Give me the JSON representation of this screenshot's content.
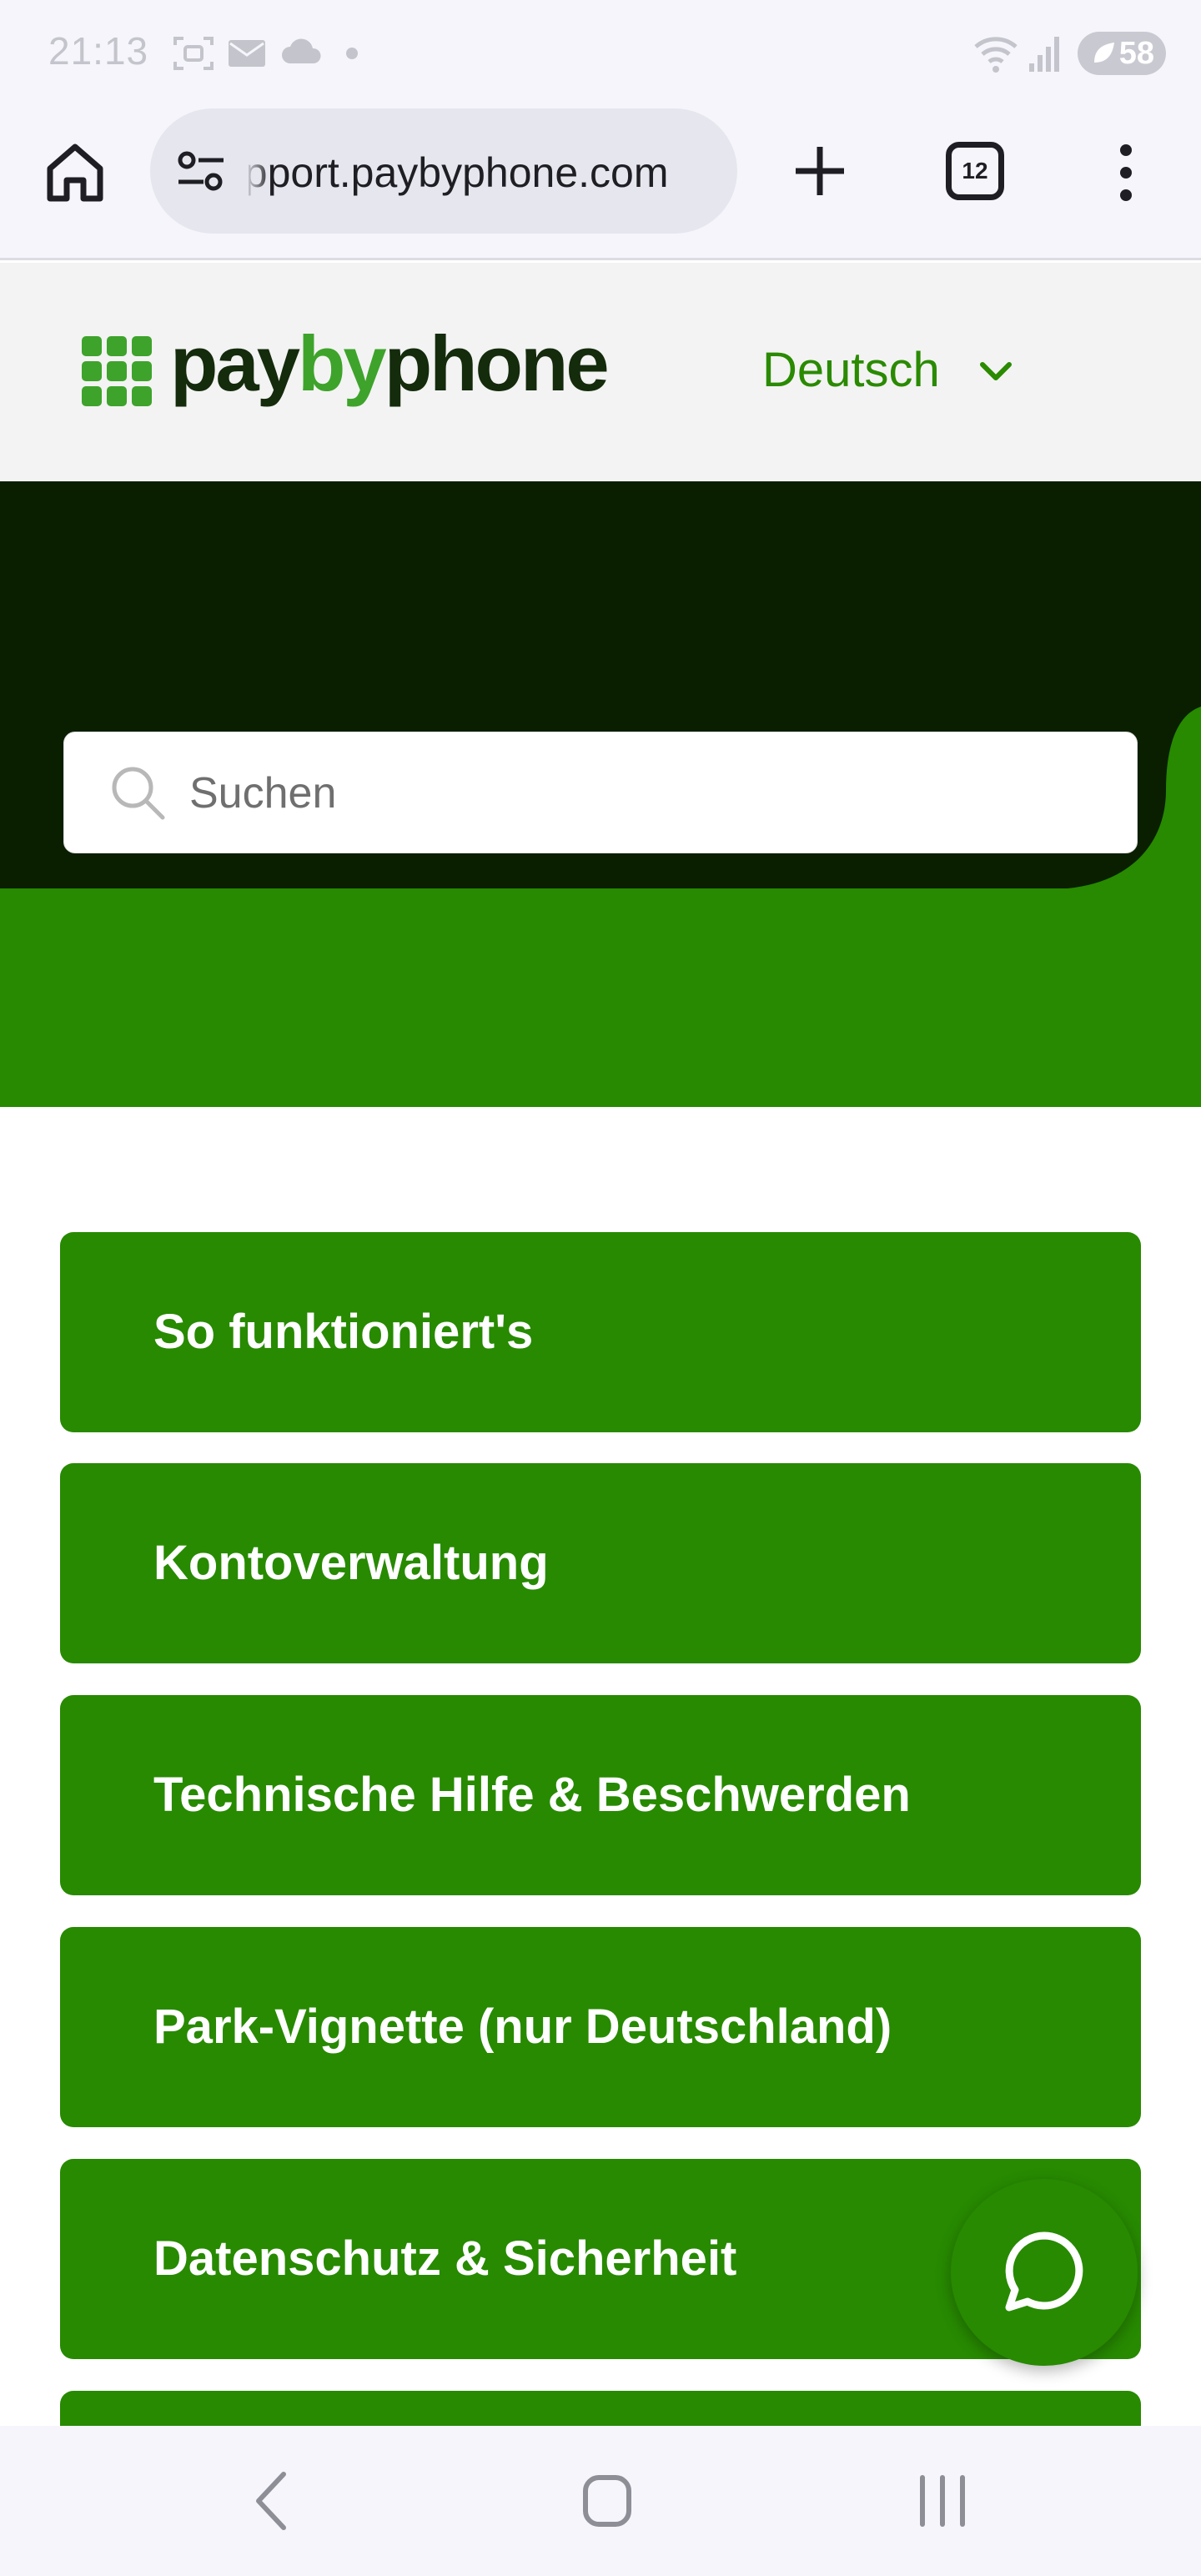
{
  "status_bar": {
    "time": "21:13",
    "battery": "58",
    "icons": [
      "screenshot-icon",
      "mail-icon",
      "cloud-icon",
      "dot-icon",
      "wifi-icon",
      "signal-icon",
      "battery-icon"
    ]
  },
  "browser": {
    "url": "support.paybyphone.com",
    "tab_count": "12",
    "icons": [
      "home-icon",
      "site-settings-icon",
      "new-tab-icon",
      "tab-switcher-icon",
      "overflow-menu-icon"
    ]
  },
  "header": {
    "logo_pre": "pay",
    "logo_by": "by",
    "logo_post": "phone",
    "language": "Deutsch"
  },
  "search": {
    "placeholder": "Suchen"
  },
  "categories": [
    {
      "label": "So funktioniert's"
    },
    {
      "label": "Kontoverwaltung"
    },
    {
      "label": "Technische Hilfe & Beschwerden"
    },
    {
      "label": "Park-Vignette (nur Deutschland)"
    },
    {
      "label": "Datenschutz & Sicherheit"
    }
  ],
  "colors": {
    "brand_green": "#278a00",
    "dark_green": "#0a1f00",
    "logo_green": "#3ea32b",
    "logo_dark": "#142b0c"
  }
}
